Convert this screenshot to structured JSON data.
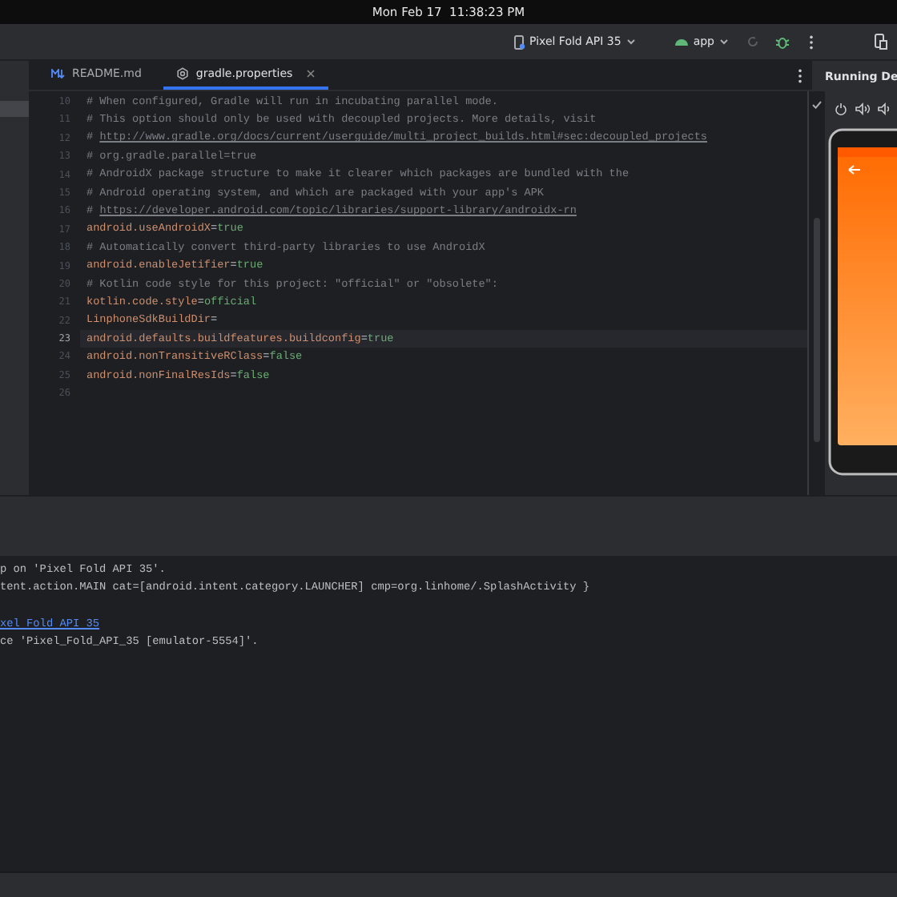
{
  "system_bar": {
    "datetime": "Mon Feb 17  11:38:23 PM"
  },
  "toolbar": {
    "device": "Pixel Fold API 35",
    "run_config": "app"
  },
  "tabs": [
    {
      "label": "README.md",
      "selected": false,
      "kind": "markdown"
    },
    {
      "label": "gradle.properties",
      "selected": true,
      "kind": "settings"
    }
  ],
  "editor": {
    "lines": [
      {
        "number": "10",
        "kind": "comment",
        "text": "# When configured, Gradle will run in incubating parallel mode.",
        "current": false
      },
      {
        "number": "11",
        "kind": "comment",
        "text": "# This option should only be used with decoupled projects. More details, visit",
        "current": false
      },
      {
        "number": "12",
        "kind": "link",
        "prefix": "#",
        "url": "http://www.gradle.org/docs/current/userguide/multi_project_builds.html#sec:decoupled_projects",
        "current": false
      },
      {
        "number": "13",
        "kind": "comment",
        "text": "# org.gradle.parallel=true",
        "current": false
      },
      {
        "number": "14",
        "kind": "comment",
        "text": "# AndroidX package structure to make it clearer which packages are bundled with the",
        "current": false
      },
      {
        "number": "15",
        "kind": "comment",
        "text": "# Android operating system, and which are packaged with your app's APK",
        "current": false
      },
      {
        "number": "16",
        "kind": "link",
        "prefix": "#",
        "url": "https://developer.android.com/topic/libraries/support-library/androidx-rn",
        "current": false
      },
      {
        "number": "17",
        "kind": "property",
        "key": "android.useAndroidX",
        "sep": "=",
        "value": "true",
        "current": false
      },
      {
        "number": "18",
        "kind": "comment",
        "text": "# Automatically convert third-party libraries to use AndroidX",
        "current": false
      },
      {
        "number": "19",
        "kind": "property",
        "key": "android.enableJetifier",
        "sep": "=",
        "value": "true",
        "current": false
      },
      {
        "number": "20",
        "kind": "comment",
        "text": "# Kotlin code style for this project: \"official\" or \"obsolete\":",
        "current": false
      },
      {
        "number": "21",
        "kind": "property",
        "key": "kotlin.code.style",
        "sep": "=",
        "value": "official",
        "current": false
      },
      {
        "number": "22",
        "kind": "property",
        "key": "LinphoneSdkBuildDir",
        "sep": "=",
        "current": false
      },
      {
        "number": "23",
        "kind": "property",
        "key": "android.defaults.buildfeatures.buildconfig",
        "sep": "=",
        "value": "true",
        "current": true
      },
      {
        "number": "24",
        "kind": "property",
        "key": "android.nonTransitiveRClass",
        "sep": "=",
        "value": "false",
        "current": false
      },
      {
        "number": "25",
        "kind": "property",
        "key": "android.nonFinalResIds",
        "sep": "=",
        "value": "false",
        "current": false
      },
      {
        "number": "26",
        "kind": "empty",
        "current": false
      }
    ]
  },
  "device_panel": {
    "title": "Running De"
  },
  "console": {
    "lines": [
      {
        "kind": "text",
        "text": "p on 'Pixel Fold API 35'."
      },
      {
        "kind": "text",
        "text": "tent.action.MAIN cat=[android.intent.category.LAUNCHER] cmp=org.linhome/.SplashActivity }"
      },
      {
        "kind": "blank"
      },
      {
        "kind": "link",
        "text": "xel Fold API 35"
      },
      {
        "kind": "text",
        "text": "ce 'Pixel_Fold_API_35 [emulator-5554]'."
      }
    ]
  }
}
